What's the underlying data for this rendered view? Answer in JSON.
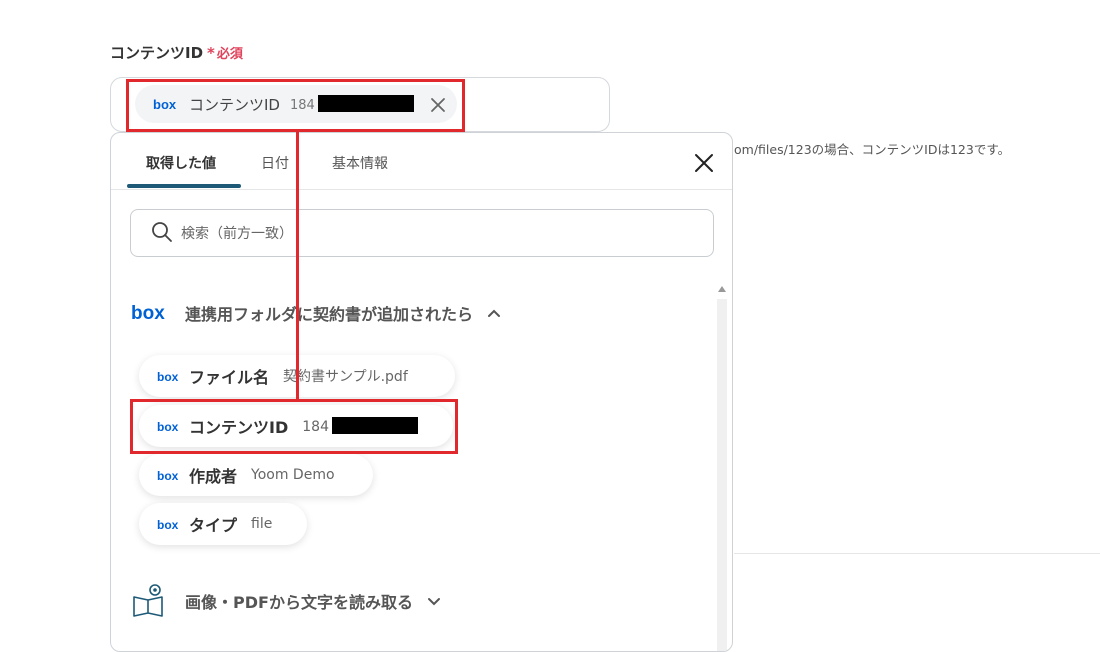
{
  "field": {
    "label": "コンテンツID",
    "required_mark": "*",
    "required_text": "必須",
    "selected_chip": {
      "label": "コンテンツID",
      "value_prefix": "184"
    },
    "help_text": "om/files/123の場合、コンテンツIDは123です。"
  },
  "popup": {
    "tabs": [
      {
        "label": "取得した値",
        "active": true
      },
      {
        "label": "日付",
        "active": false
      },
      {
        "label": "基本情報",
        "active": false
      }
    ],
    "search_placeholder": "検索（前方一致）",
    "sections": [
      {
        "title": "連携用フォルダに契約書が追加されたら",
        "expanded": true,
        "items": [
          {
            "label": "ファイル名",
            "value": "契約書サンプル.pdf"
          },
          {
            "label": "コンテンツID",
            "value": "184"
          },
          {
            "label": "作成者",
            "value": "Yoom Demo"
          },
          {
            "label": "タイプ",
            "value": "file"
          }
        ]
      },
      {
        "title": "画像・PDFから文字を読み取る",
        "expanded": false
      }
    ]
  },
  "icons": {
    "box_logo": "box-logo-icon",
    "close": "close-icon",
    "search": "search-icon",
    "chevron_up": "chevron-up-icon",
    "chevron_down": "chevron-down-icon",
    "ocr_book": "book-eye-icon"
  },
  "colors": {
    "accent": "#1e5a77",
    "required": "#e0435b",
    "box_blue": "#0061d5",
    "highlight": "#e0282d"
  }
}
